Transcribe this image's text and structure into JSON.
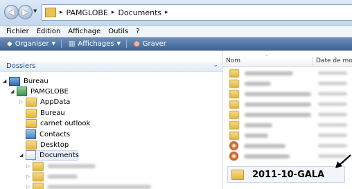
{
  "address_bar": {
    "path": [
      "PAMGLOBE",
      "Documents"
    ]
  },
  "menu": {
    "items": [
      "Fichier",
      "Edition",
      "Affichage",
      "Outils",
      "?"
    ]
  },
  "toolbar": {
    "organize_label": "Organiser",
    "views_label": "Affichages",
    "burn_label": "Graver"
  },
  "nav_pane": {
    "section_title": "Dossiers",
    "tree": [
      {
        "label": "Bureau",
        "icon": "desktop-icon"
      },
      {
        "label": "PAMGLOBE",
        "icon": "user-folder-icon"
      },
      {
        "label": "AppData",
        "icon": "folder-icon"
      },
      {
        "label": "Bureau",
        "icon": "folder-icon"
      },
      {
        "label": "carnet outlook",
        "icon": "folder-icon"
      },
      {
        "label": "Contacts",
        "icon": "contacts-icon"
      },
      {
        "label": "Desktop",
        "icon": "folder-icon"
      },
      {
        "label": "Documents",
        "icon": "documents-icon",
        "selected": true
      }
    ]
  },
  "content_pane": {
    "columns": [
      "Nom",
      "Date de mo"
    ],
    "highlighted_folder": "2011-10-GALA"
  }
}
